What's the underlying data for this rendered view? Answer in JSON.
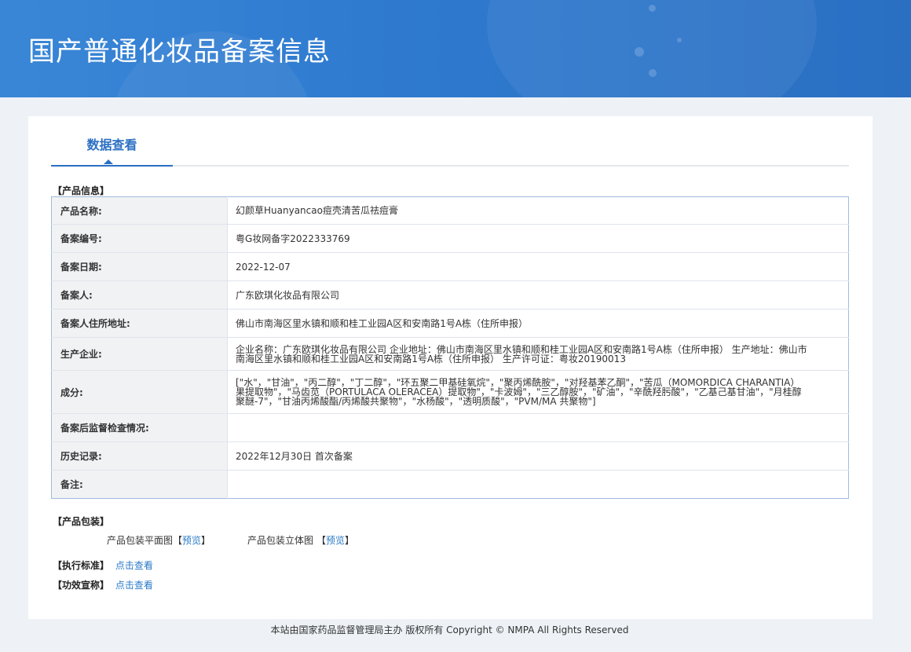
{
  "header": {
    "title": "国产普通化妆品备案信息"
  },
  "tabs": {
    "active_label": "数据查看"
  },
  "product_info": {
    "section_title": "【产品信息】",
    "rows": [
      {
        "label": "产品名称:",
        "value": "幻颜草Huanyancao痘壳清苦瓜祛痘膏"
      },
      {
        "label": "备案编号:",
        "value": "粤G妆网备字2022333769"
      },
      {
        "label": "备案日期:",
        "value": "2022-12-07"
      },
      {
        "label": "备案人:",
        "value": "广东欧琪化妆品有限公司"
      },
      {
        "label": "备案人住所地址:",
        "value": "佛山市南海区里水镇和顺和桂工业园A区和安南路1号A栋（住所申报）"
      },
      {
        "label": "生产企业:",
        "value": "企业名称：广东欧琪化妆品有限公司 企业地址：佛山市南海区里水镇和顺和桂工业园A区和安南路1号A栋（住所申报） 生产地址：佛山市南海区里水镇和顺和桂工业园A区和安南路1号A栋（住所申报） 生产许可证：粤妆20190013"
      },
      {
        "label": "成分:",
        "value": "[\"水\"，\"甘油\"，\"丙二醇\"，\"丁二醇\"，\"环五聚二甲基硅氧烷\"，\"聚丙烯酰胺\"，\"对羟基苯乙酮\"，\"苦瓜（MOMORDICA CHARANTIA）果提取物\"，\"马齿苋（PORTULACA OLERACEA）提取物\"，\"卡波姆\"，\"三乙醇胺\"，\"矿油\"，\"辛酰羟肟酸\"，\"乙基己基甘油\"，\"月桂醇聚醚-7\"，\"甘油丙烯酸酯/丙烯酸共聚物\"，\"水杨酸\"，\"透明质酸\"，\"PVM/MA 共聚物\"]"
      },
      {
        "label": "备案后监督检查情况:",
        "value": ""
      },
      {
        "label": "历史记录:",
        "value": "2022年12月30日 首次备案"
      },
      {
        "label": "备注:",
        "value": ""
      }
    ]
  },
  "packaging": {
    "section_title": "【产品包装】",
    "flat_label": "产品包装平面图",
    "three_d_label": "产品包装立体图",
    "bracket_open": "【",
    "bracket_close": "】",
    "preview_link": "预览"
  },
  "standard": {
    "section_title": "【执行标准】",
    "link": "点击查看"
  },
  "efficacy": {
    "section_title": "【功效宣称】",
    "link": "点击查看"
  },
  "footer": {
    "text": "本站由国家药品监督管理局主办 版权所有 Copyright © NMPA All Rights Reserved"
  }
}
